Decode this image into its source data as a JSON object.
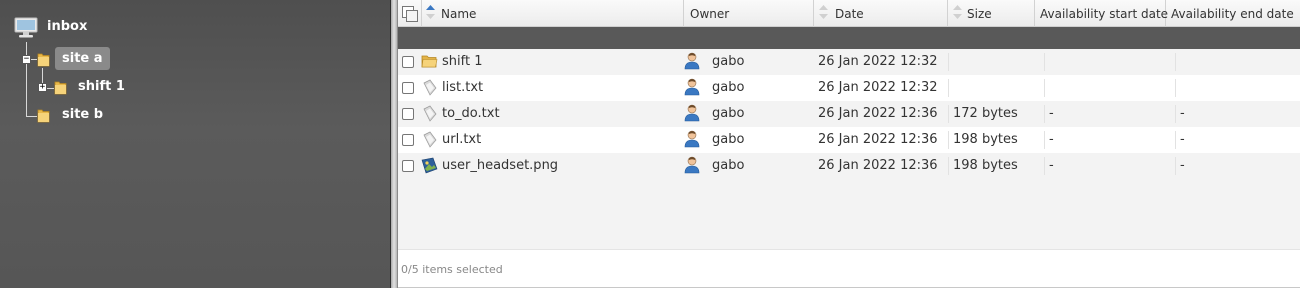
{
  "tree": {
    "root_label": "inbox",
    "nodes": [
      {
        "label": "site a",
        "selected": true,
        "expanded": true
      },
      {
        "label": "shift 1",
        "selected": false,
        "expanded": false
      },
      {
        "label": "site b",
        "selected": false,
        "expanded": false
      }
    ]
  },
  "grid": {
    "columns": {
      "name": "Name",
      "owner": "Owner",
      "date": "Date",
      "size": "Size",
      "avail_start": "Availability start date",
      "avail_end": "Availability end date"
    },
    "rows": [
      {
        "name": "shift 1",
        "type": "folder",
        "owner": "gabo",
        "date": "26 Jan 2022 12:32",
        "size": "",
        "avail_start": "",
        "avail_end": ""
      },
      {
        "name": "list.txt",
        "type": "file",
        "owner": "gabo",
        "date": "26 Jan 2022 12:32",
        "size": "",
        "avail_start": "",
        "avail_end": ""
      },
      {
        "name": "to_do.txt",
        "type": "file",
        "owner": "gabo",
        "date": "26 Jan 2022 12:36",
        "size": "172 bytes",
        "avail_start": "-",
        "avail_end": "-"
      },
      {
        "name": "url.txt",
        "type": "file",
        "owner": "gabo",
        "date": "26 Jan 2022 12:36",
        "size": "198 bytes",
        "avail_start": "-",
        "avail_end": "-"
      },
      {
        "name": "user_headset.png",
        "type": "image",
        "owner": "gabo",
        "date": "26 Jan 2022 12:36",
        "size": "198 bytes",
        "avail_start": "-",
        "avail_end": "-"
      }
    ],
    "status": "0/5 items selected"
  },
  "colors": {
    "tree_background": "#565656",
    "filter_bar": "#595959",
    "folder": "#e8b84a"
  },
  "icons": {
    "root": "computer-icon",
    "folder": "folder-icon",
    "file": "document-icon",
    "image": "image-file-icon",
    "owner": "user-icon",
    "select_all": "select-all-icon",
    "sort": "sort-arrows-icon"
  }
}
